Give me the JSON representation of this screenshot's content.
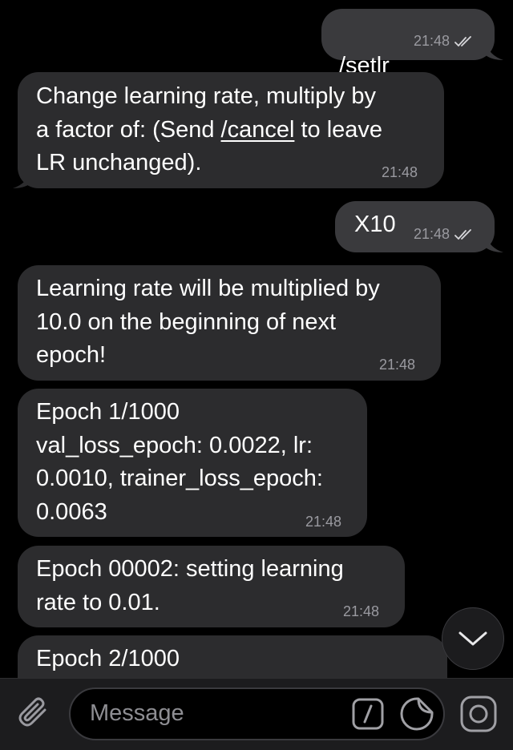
{
  "messages": [
    {
      "direction": "out",
      "text": "/setlr",
      "is_command": true,
      "time": "21:48"
    },
    {
      "direction": "in",
      "parts": [
        "Change learning rate, multiply by\na factor of: (Send ",
        "/cancel",
        " to leave\nLR unchanged)."
      ],
      "time": "21:48"
    },
    {
      "direction": "out",
      "text": "X10",
      "time": "21:48"
    },
    {
      "direction": "in",
      "text": "Learning rate will be multiplied by\n10.0 on the beginning of next\nepoch!",
      "time": "21:48"
    },
    {
      "direction": "in",
      "text": "Epoch 1/1000\nval_loss_epoch: 0.0022, lr:\n0.0010, trainer_loss_epoch:\n0.0063",
      "time": "21:48"
    },
    {
      "direction": "in",
      "text": "Epoch 00002: setting learning\nrate to 0.01.",
      "time": "21:48"
    },
    {
      "direction": "in",
      "text": "Epoch 2/1000"
    }
  ],
  "input": {
    "placeholder": "Message"
  },
  "icons": {
    "attach": "paperclip-icon",
    "command": "slash-command-icon",
    "sticker": "sticker-icon",
    "camera": "camera-icon",
    "scroll": "chevron-down-icon",
    "read": "double-check-icon"
  },
  "colors": {
    "background": "#000000",
    "outgoing_bubble": "#3a3a3d",
    "incoming_bubble": "#2c2c2e",
    "timestamp": "#9a9aa0"
  }
}
